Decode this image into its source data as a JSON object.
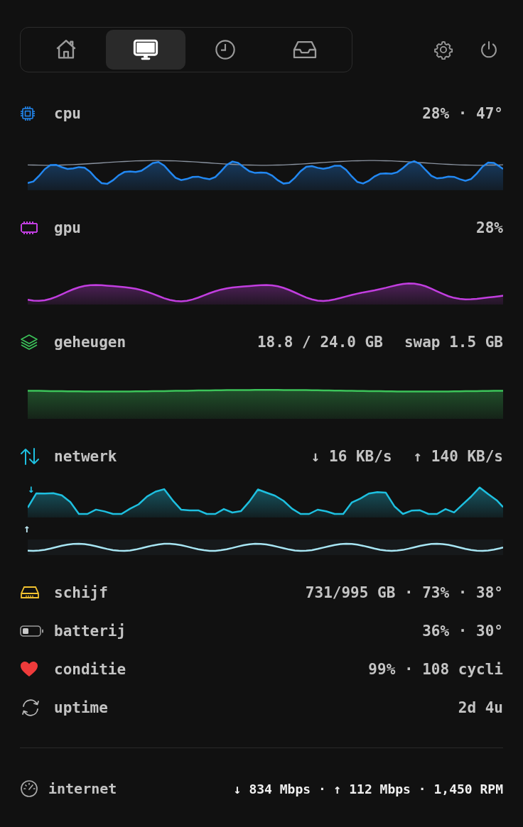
{
  "nav": {
    "tabs": [
      {
        "kind": "home",
        "selected": false
      },
      {
        "kind": "monitor",
        "selected": true
      },
      {
        "kind": "history",
        "selected": false
      },
      {
        "kind": "inbox",
        "selected": false
      }
    ]
  },
  "sections": [
    {
      "kind": "cpu",
      "label": "cpu",
      "color": "#2288f2",
      "values": [
        "28% · 47°"
      ]
    },
    {
      "kind": "gpu",
      "label": "gpu",
      "color": "#c23ee0",
      "values": [
        "28%"
      ]
    },
    {
      "kind": "memory",
      "label": "geheugen",
      "color": "#3cc45a",
      "values": [
        "18.8 / 24.0 GB",
        "swap 1.5 GB"
      ]
    },
    {
      "kind": "network",
      "label": "netwerk",
      "color": "#1ec0e0",
      "values": [
        "↓ 16 KB/s",
        "↑ 140 KB/s"
      ],
      "markers": [
        "↓",
        "↑"
      ]
    }
  ],
  "stats": [
    {
      "kind": "disk",
      "label": "schijf",
      "value": "731/995 GB · 73% · 38°"
    },
    {
      "kind": "battery",
      "label": "batterij",
      "value": "36% · 30°"
    },
    {
      "kind": "health",
      "label": "conditie",
      "value": "99% · 108 cycli"
    },
    {
      "kind": "uptime",
      "label": "uptime",
      "value": "2d 4u"
    }
  ],
  "footer": {
    "label": "internet",
    "value": "↓ 834 Mbps · ↑ 112 Mbps · 1,450 RPM"
  }
}
